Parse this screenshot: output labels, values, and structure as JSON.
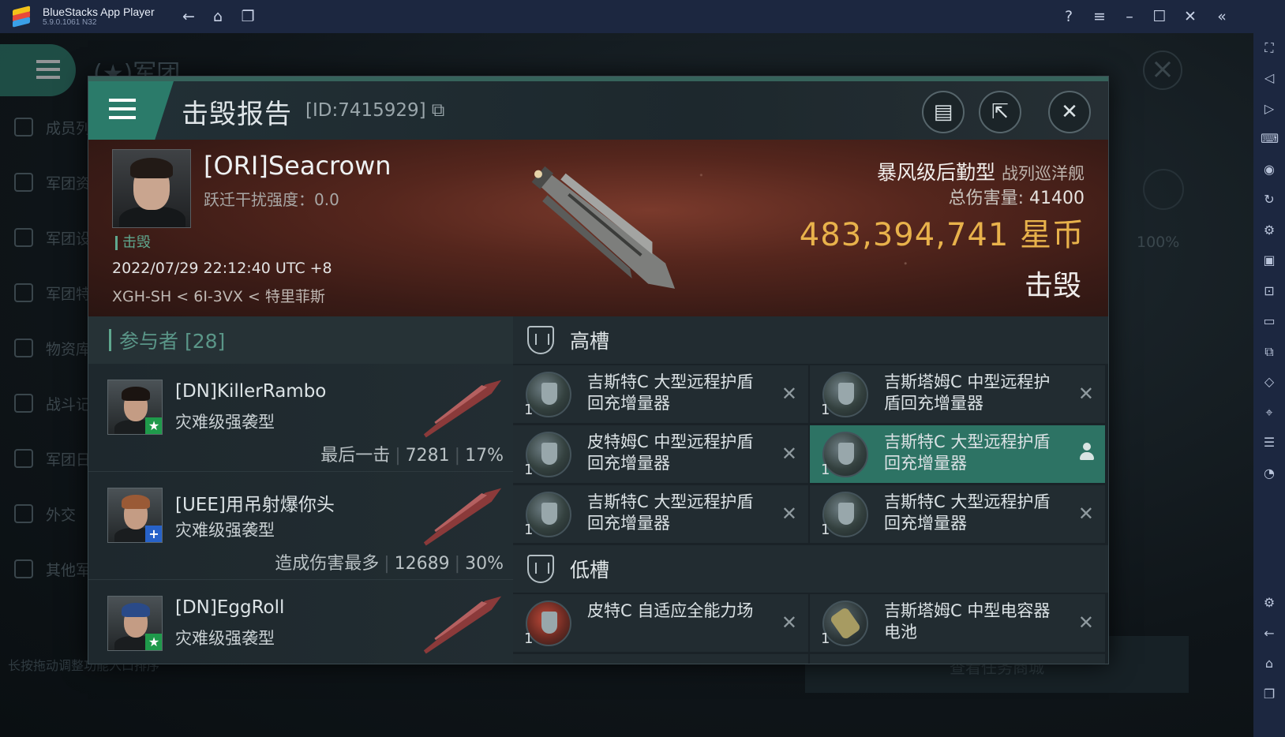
{
  "window": {
    "app_title": "BlueStacks App Player",
    "version": "5.9.0.1061 N32"
  },
  "background": {
    "title": "(★)军团",
    "side_items": [
      "成员列",
      "军团资",
      "军团设",
      "军团特",
      "物资库",
      "战斗记",
      "军团日",
      "外交",
      "其他军"
    ],
    "percent": "100%",
    "hint": "长按拖动调整功能入口排序",
    "bottom_button": "查看任务商城"
  },
  "dialog": {
    "title": "击毁报告",
    "report_id": "[ID:7415929]"
  },
  "victim": {
    "name": "[ORI]Seacrown",
    "warp_label": "跃迁干扰强度：",
    "warp_value": "0.0",
    "tag": "击毁",
    "time": "2022/07/29 22:12:40 UTC +8",
    "location": "XGH-SH < 6I-3VX < 特里菲斯",
    "ship_name": "暴风级后勤型",
    "ship_class": "战列巡洋舰",
    "total_damage_label": "总伤害量: ",
    "total_damage": "41400",
    "isk_value": "483,394,741",
    "isk_unit": "星币",
    "status": "击毁"
  },
  "participants": {
    "header": "参与者 [28]",
    "items": [
      {
        "name": "[DN]KillerRambo",
        "ship": "灾难级强袭型",
        "label": "最后一击",
        "damage": "7281",
        "percent": "17%",
        "badge": "★",
        "badge_color": "#1f9a4b",
        "hair": "#1b1411"
      },
      {
        "name": "[UEE]用吊射爆你头",
        "ship": "灾难级强袭型",
        "label": "造成伤害最多",
        "damage": "12689",
        "percent": "30%",
        "badge": "+",
        "badge_color": "#2762c9",
        "hair": "#9a5a36"
      },
      {
        "name": "[DN]EggRoll",
        "ship": "灾难级强袭型",
        "label": "",
        "damage": "",
        "percent": "",
        "badge": "★",
        "badge_color": "#1f9a4b",
        "hair": "#2a4a88"
      }
    ]
  },
  "fitting": {
    "high_slot_label": "高槽",
    "low_slot_label": "低槽",
    "high": [
      {
        "qty": "1",
        "name": "吉斯特C 大型远程护盾回充增量器",
        "state": "x",
        "icon": "shield"
      },
      {
        "qty": "1",
        "name": "吉斯塔姆C 中型远程护盾回充增量器",
        "state": "x",
        "icon": "shield"
      },
      {
        "qty": "1",
        "name": "皮特姆C 中型远程护盾回充增量器",
        "state": "x",
        "icon": "shield"
      },
      {
        "qty": "1",
        "name": "吉斯特C 大型远程护盾回充增量器",
        "state": "pilot",
        "icon": "shield"
      },
      {
        "qty": "1",
        "name": "吉斯特C 大型远程护盾回充增量器",
        "state": "x",
        "icon": "shield"
      },
      {
        "qty": "1",
        "name": "吉斯特C 大型远程护盾回充增量器",
        "state": "x",
        "icon": "shield"
      }
    ],
    "low": [
      {
        "qty": "1",
        "name": "皮特C 自适应全能力场",
        "state": "x",
        "icon": "red"
      },
      {
        "qty": "1",
        "name": "吉斯塔姆C 中型电容器电池",
        "state": "x",
        "icon": "cap"
      }
    ]
  },
  "colors": {
    "accent": "#2b7b6a",
    "isk": "#e8b24b",
    "highlight_row": "#2d7364"
  }
}
